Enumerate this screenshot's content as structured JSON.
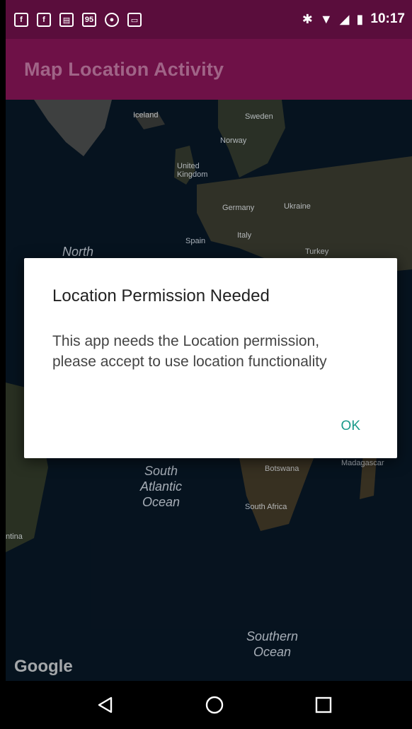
{
  "status_bar": {
    "notification_icons": [
      "facebook-icon",
      "facebook-icon",
      "clipboard-icon",
      "badge-icon",
      "android-icon",
      "image-icon"
    ],
    "badge_text": "95",
    "time": "10:17"
  },
  "toolbar": {
    "title": "Map Location Activity"
  },
  "map": {
    "labels": {
      "iceland": "Iceland",
      "sweden": "Sweden",
      "norway": "Norway",
      "united_kingdom": "United\nKingdom",
      "germany": "Germany",
      "ukraine": "Ukraine",
      "spain": "Spain",
      "italy": "Italy",
      "turkey": "Turkey",
      "north": "North",
      "south_atlantic_ocean": "South\nAtlantic\nOcean",
      "botswana": "Botswana",
      "madagascar": "Madagascar",
      "south_africa": "South Africa",
      "argentina": "ntina",
      "southern_ocean": "Southern\nOcean"
    },
    "logo": "Google"
  },
  "dialog": {
    "title": "Location Permission Needed",
    "message": "This app needs the Location permission, please accept to use location functionality",
    "ok_label": "OK"
  },
  "colors": {
    "status_bar": "#5a0d3c",
    "toolbar": "#6e1147",
    "accent": "#1a9a8a"
  }
}
